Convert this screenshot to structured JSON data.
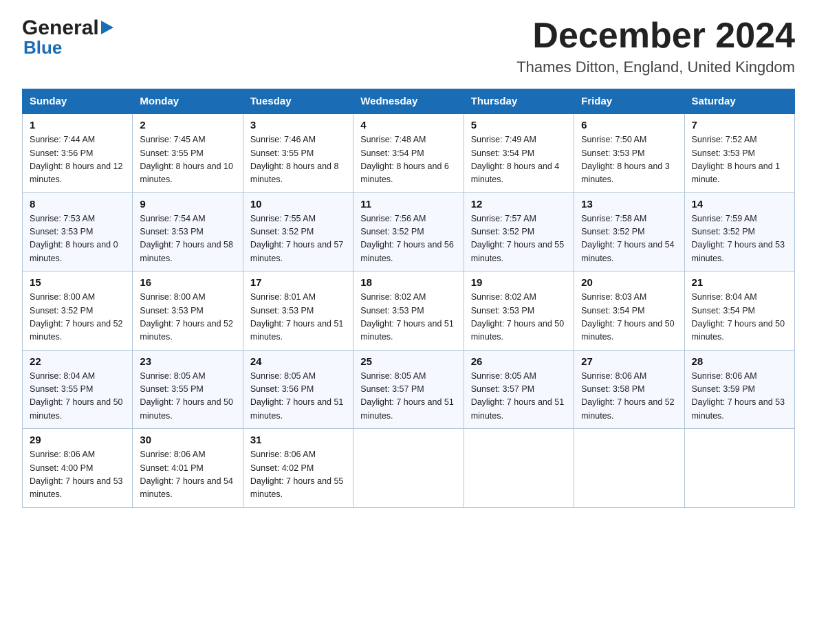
{
  "header": {
    "logo_general": "General",
    "logo_blue": "Blue",
    "month_title": "December 2024",
    "location": "Thames Ditton, England, United Kingdom"
  },
  "days_of_week": [
    "Sunday",
    "Monday",
    "Tuesday",
    "Wednesday",
    "Thursday",
    "Friday",
    "Saturday"
  ],
  "weeks": [
    [
      {
        "day": "1",
        "sunrise": "7:44 AM",
        "sunset": "3:56 PM",
        "daylight": "8 hours and 12 minutes."
      },
      {
        "day": "2",
        "sunrise": "7:45 AM",
        "sunset": "3:55 PM",
        "daylight": "8 hours and 10 minutes."
      },
      {
        "day": "3",
        "sunrise": "7:46 AM",
        "sunset": "3:55 PM",
        "daylight": "8 hours and 8 minutes."
      },
      {
        "day": "4",
        "sunrise": "7:48 AM",
        "sunset": "3:54 PM",
        "daylight": "8 hours and 6 minutes."
      },
      {
        "day": "5",
        "sunrise": "7:49 AM",
        "sunset": "3:54 PM",
        "daylight": "8 hours and 4 minutes."
      },
      {
        "day": "6",
        "sunrise": "7:50 AM",
        "sunset": "3:53 PM",
        "daylight": "8 hours and 3 minutes."
      },
      {
        "day": "7",
        "sunrise": "7:52 AM",
        "sunset": "3:53 PM",
        "daylight": "8 hours and 1 minute."
      }
    ],
    [
      {
        "day": "8",
        "sunrise": "7:53 AM",
        "sunset": "3:53 PM",
        "daylight": "8 hours and 0 minutes."
      },
      {
        "day": "9",
        "sunrise": "7:54 AM",
        "sunset": "3:53 PM",
        "daylight": "7 hours and 58 minutes."
      },
      {
        "day": "10",
        "sunrise": "7:55 AM",
        "sunset": "3:52 PM",
        "daylight": "7 hours and 57 minutes."
      },
      {
        "day": "11",
        "sunrise": "7:56 AM",
        "sunset": "3:52 PM",
        "daylight": "7 hours and 56 minutes."
      },
      {
        "day": "12",
        "sunrise": "7:57 AM",
        "sunset": "3:52 PM",
        "daylight": "7 hours and 55 minutes."
      },
      {
        "day": "13",
        "sunrise": "7:58 AM",
        "sunset": "3:52 PM",
        "daylight": "7 hours and 54 minutes."
      },
      {
        "day": "14",
        "sunrise": "7:59 AM",
        "sunset": "3:52 PM",
        "daylight": "7 hours and 53 minutes."
      }
    ],
    [
      {
        "day": "15",
        "sunrise": "8:00 AM",
        "sunset": "3:52 PM",
        "daylight": "7 hours and 52 minutes."
      },
      {
        "day": "16",
        "sunrise": "8:00 AM",
        "sunset": "3:53 PM",
        "daylight": "7 hours and 52 minutes."
      },
      {
        "day": "17",
        "sunrise": "8:01 AM",
        "sunset": "3:53 PM",
        "daylight": "7 hours and 51 minutes."
      },
      {
        "day": "18",
        "sunrise": "8:02 AM",
        "sunset": "3:53 PM",
        "daylight": "7 hours and 51 minutes."
      },
      {
        "day": "19",
        "sunrise": "8:02 AM",
        "sunset": "3:53 PM",
        "daylight": "7 hours and 50 minutes."
      },
      {
        "day": "20",
        "sunrise": "8:03 AM",
        "sunset": "3:54 PM",
        "daylight": "7 hours and 50 minutes."
      },
      {
        "day": "21",
        "sunrise": "8:04 AM",
        "sunset": "3:54 PM",
        "daylight": "7 hours and 50 minutes."
      }
    ],
    [
      {
        "day": "22",
        "sunrise": "8:04 AM",
        "sunset": "3:55 PM",
        "daylight": "7 hours and 50 minutes."
      },
      {
        "day": "23",
        "sunrise": "8:05 AM",
        "sunset": "3:55 PM",
        "daylight": "7 hours and 50 minutes."
      },
      {
        "day": "24",
        "sunrise": "8:05 AM",
        "sunset": "3:56 PM",
        "daylight": "7 hours and 51 minutes."
      },
      {
        "day": "25",
        "sunrise": "8:05 AM",
        "sunset": "3:57 PM",
        "daylight": "7 hours and 51 minutes."
      },
      {
        "day": "26",
        "sunrise": "8:05 AM",
        "sunset": "3:57 PM",
        "daylight": "7 hours and 51 minutes."
      },
      {
        "day": "27",
        "sunrise": "8:06 AM",
        "sunset": "3:58 PM",
        "daylight": "7 hours and 52 minutes."
      },
      {
        "day": "28",
        "sunrise": "8:06 AM",
        "sunset": "3:59 PM",
        "daylight": "7 hours and 53 minutes."
      }
    ],
    [
      {
        "day": "29",
        "sunrise": "8:06 AM",
        "sunset": "4:00 PM",
        "daylight": "7 hours and 53 minutes."
      },
      {
        "day": "30",
        "sunrise": "8:06 AM",
        "sunset": "4:01 PM",
        "daylight": "7 hours and 54 minutes."
      },
      {
        "day": "31",
        "sunrise": "8:06 AM",
        "sunset": "4:02 PM",
        "daylight": "7 hours and 55 minutes."
      },
      null,
      null,
      null,
      null
    ]
  ]
}
